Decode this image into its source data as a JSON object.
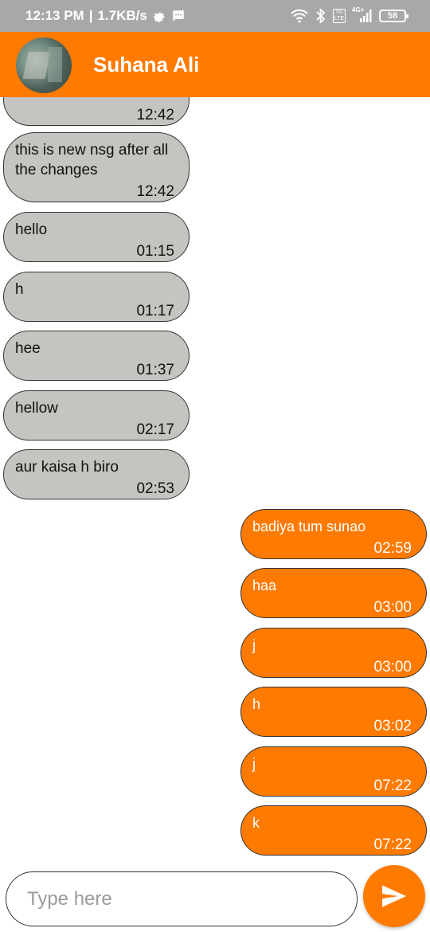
{
  "status_bar": {
    "time": "12:13 PM",
    "separator": "|",
    "speed": "1.7KB/s",
    "network_label": "4G+",
    "volte_label": "Vo LTE",
    "battery": "58",
    "icons": [
      "settings-icon",
      "message-icon",
      "wifi-icon",
      "bluetooth-icon",
      "volte-icon",
      "signal-icon",
      "battery-icon"
    ]
  },
  "header": {
    "contact_name": "Suhana Ali"
  },
  "colors": {
    "accent": "#ff7a00",
    "incoming_bubble": "#c6c4c0",
    "status_bar": "#a8a8a8"
  },
  "messages": [
    {
      "direction": "in",
      "text": "",
      "time": "12:42"
    },
    {
      "direction": "in",
      "text": "this is new nsg after all the changes",
      "time": "12:42"
    },
    {
      "direction": "in",
      "text": "hello",
      "time": "01:15"
    },
    {
      "direction": "in",
      "text": "h",
      "time": "01:17"
    },
    {
      "direction": "in",
      "text": "hee",
      "time": "01:37"
    },
    {
      "direction": "in",
      "text": "hellow",
      "time": "02:17"
    },
    {
      "direction": "in",
      "text": "aur kaisa h biro",
      "time": "02:53"
    },
    {
      "direction": "out",
      "text": "badiya tum sunao",
      "time": "02:59"
    },
    {
      "direction": "out",
      "text": "haa",
      "time": "03:00"
    },
    {
      "direction": "out",
      "text": "j",
      "time": "03:00"
    },
    {
      "direction": "out",
      "text": "h",
      "time": "03:02"
    },
    {
      "direction": "out",
      "text": "j",
      "time": "07:22"
    },
    {
      "direction": "out",
      "text": "k",
      "time": "07:22"
    }
  ],
  "composer": {
    "placeholder": "Type here",
    "value": "",
    "send_icon": "send-icon"
  }
}
